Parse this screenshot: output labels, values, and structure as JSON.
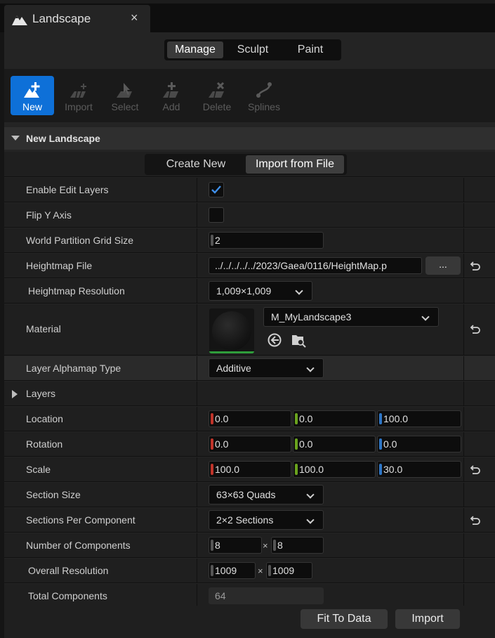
{
  "tab": {
    "title": "Landscape",
    "close": "×"
  },
  "modes": [
    "Manage",
    "Sculpt",
    "Paint"
  ],
  "tools": [
    {
      "label": "New",
      "icon": "new-landscape-icon"
    },
    {
      "label": "Import",
      "icon": "import-icon"
    },
    {
      "label": "Select",
      "icon": "select-icon"
    },
    {
      "label": "Add",
      "icon": "add-component-icon"
    },
    {
      "label": "Delete",
      "icon": "delete-component-icon"
    },
    {
      "label": "Splines",
      "icon": "splines-icon"
    }
  ],
  "section": {
    "title": "New Landscape"
  },
  "create_mode": {
    "create": "Create New",
    "import": "Import from File"
  },
  "props": {
    "enable_edit_layers": {
      "label": "Enable Edit Layers",
      "checked": true
    },
    "flip_y": {
      "label": "Flip Y Axis",
      "checked": false
    },
    "wp_grid": {
      "label": "World Partition Grid Size",
      "value": "2"
    },
    "heightmap_file": {
      "label": "Heightmap File",
      "value": "../../../../../2023/Gaea/0116/HeightMap.p",
      "browse": "..."
    },
    "heightmap_res": {
      "label": "Heightmap Resolution",
      "value": "1,009×1,009"
    },
    "material": {
      "label": "Material",
      "value": "M_MyLandscape3"
    },
    "alphamap": {
      "label": "Layer Alphamap Type",
      "value": "Additive"
    },
    "layers": {
      "label": "Layers"
    },
    "location": {
      "label": "Location",
      "x": "0.0",
      "y": "0.0",
      "z": "100.0"
    },
    "rotation": {
      "label": "Rotation",
      "x": "0.0",
      "y": "0.0",
      "z": "0.0"
    },
    "scale": {
      "label": "Scale",
      "x": "100.0",
      "y": "100.0",
      "z": "30.0"
    },
    "section_size": {
      "label": "Section Size",
      "value": "63×63 Quads"
    },
    "sections_per_comp": {
      "label": "Sections Per Component",
      "value": "2×2 Sections"
    },
    "num_components": {
      "label": "Number of Components",
      "x": "8",
      "y": "8"
    },
    "overall_res": {
      "label": "Overall Resolution",
      "x": "1009",
      "y": "1009"
    },
    "total_components": {
      "label": "Total Components",
      "value": "64"
    }
  },
  "times_sign": "×",
  "buttons": {
    "fit": "Fit To Data",
    "import": "Import"
  },
  "colors": {
    "accent": "#0e70d8",
    "x_axis": "#c0342a",
    "y_axis": "#6aa31d",
    "z_axis": "#2e76c6"
  }
}
